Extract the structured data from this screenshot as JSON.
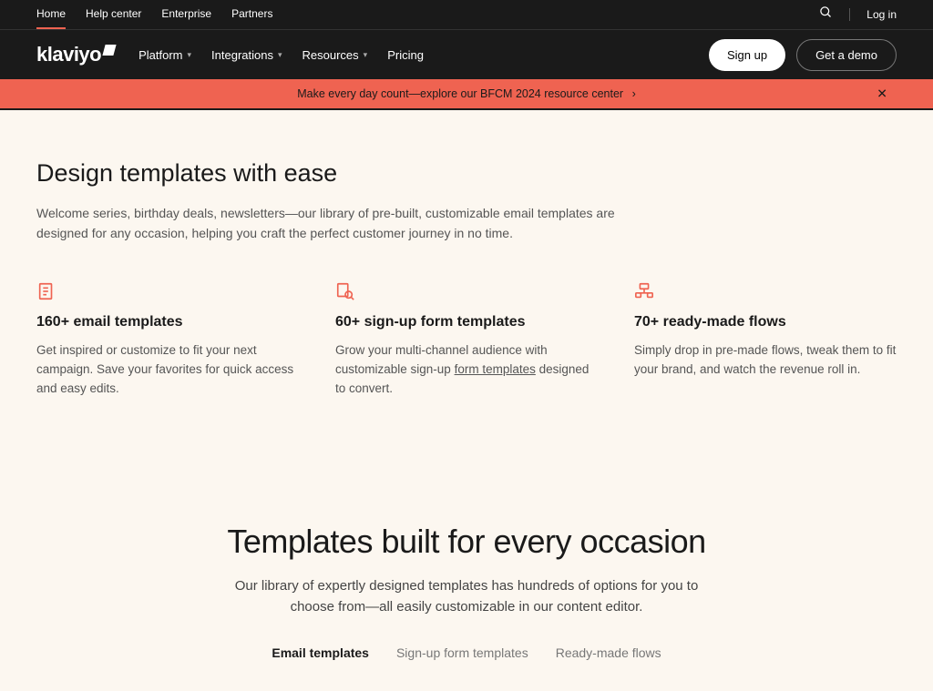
{
  "topbar": {
    "links": [
      "Home",
      "Help center",
      "Enterprise",
      "Partners"
    ],
    "login": "Log in"
  },
  "logo": "klaviyo",
  "nav": {
    "items": [
      "Platform",
      "Integrations",
      "Resources",
      "Pricing"
    ]
  },
  "cta": {
    "signup": "Sign up",
    "demo": "Get a demo"
  },
  "banner": {
    "text": "Make every day count—explore our BFCM 2024 resource center",
    "arrow": "›"
  },
  "hero": {
    "title": "Design templates with ease",
    "sub": "Welcome series, birthday deals, newsletters—our library of pre-built, customizable email templates are designed for any occasion, helping you craft the perfect customer journey in no time."
  },
  "features": [
    {
      "title": "160+ email templates",
      "body": "Get inspired or customize to fit your next campaign. Save your favorites for quick access and easy edits."
    },
    {
      "title": "60+ sign-up form templates",
      "body_pre": "Grow your multi-channel audience with customizable sign-up ",
      "body_link": "form templates",
      "body_post": " designed to convert."
    },
    {
      "title": "70+ ready-made flows",
      "body": "Simply drop in pre-made flows, tweak them to fit your brand, and watch the revenue roll in."
    }
  ],
  "section2": {
    "title": "Templates built for every occasion",
    "sub": "Our library of expertly designed templates has hundreds of options for you to choose from—all easily customizable in our content editor.",
    "tabs": [
      "Email templates",
      "Sign-up form templates",
      "Ready-made flows"
    ]
  }
}
